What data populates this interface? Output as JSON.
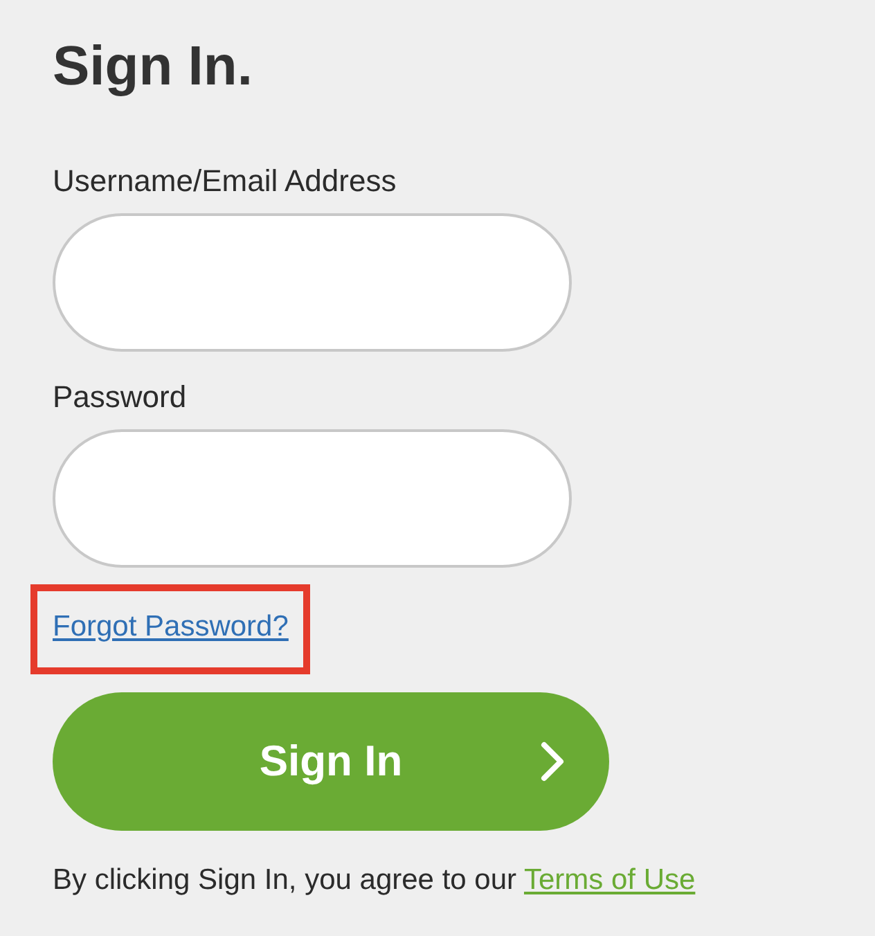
{
  "title": "Sign In.",
  "fields": [
    {
      "label": "Username/Email Address"
    },
    {
      "label": "Password"
    }
  ],
  "forgot_link": {
    "text": "Forgot Password?",
    "highlighted": true
  },
  "submit_button": {
    "label": "Sign In"
  },
  "terms": {
    "text": "By clicking Sign In, you agree to our",
    "link": "Terms of Use"
  }
}
